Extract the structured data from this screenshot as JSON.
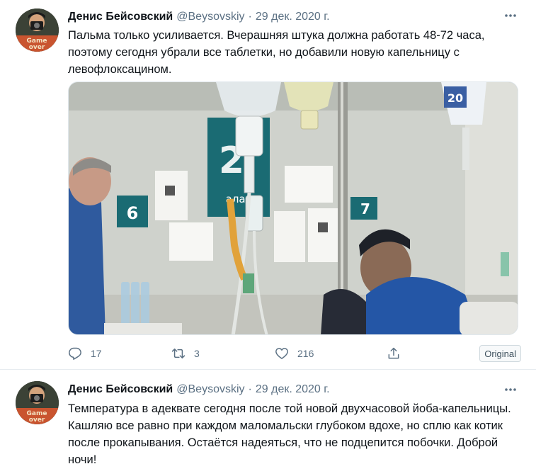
{
  "tweets": [
    {
      "author_name": "Денис Бейсовский",
      "handle": "@Beysovskiy",
      "separator": "·",
      "date": "29 дек. 2020 г.",
      "text_lines": [
        "Пальма только усиливается. Вчерашняя штука должна работать 48-72 часа,",
        "поэтому сегодня убрали все таблетки, но добавили новую капельницу с",
        "левофлоксацином."
      ],
      "replies": "17",
      "retweets": "3",
      "likes": "216",
      "badge": "Original",
      "photo_signs": {
        "left_number": "6",
        "big_number": "2",
        "partial_word": "алат",
        "right_number": "7",
        "bag_number": "20"
      }
    },
    {
      "author_name": "Денис Бейсовский",
      "handle": "@Beysovskiy",
      "separator": "·",
      "date": "29 дек. 2020 г.",
      "text_lines": [
        "Температура в адеквате сегодня после той новой двухчасовой йоба-капельницы.",
        "Кашляю все равно при каждом маломальски глубоком вдохе, но сплю как котик",
        "после прокапывания. Остаётся надеяться, что не подцепится побочки. Доброй",
        "ночи!"
      ]
    }
  ],
  "icons": {
    "reply": "reply-icon",
    "retweet": "retweet-icon",
    "like": "heart-icon",
    "share": "share-icon",
    "more": "more-icon"
  },
  "colors": {
    "text": "#0f1419",
    "secondary": "#5b7083",
    "divider": "#e6ecf0",
    "sign_teal": "#1a6b73"
  }
}
